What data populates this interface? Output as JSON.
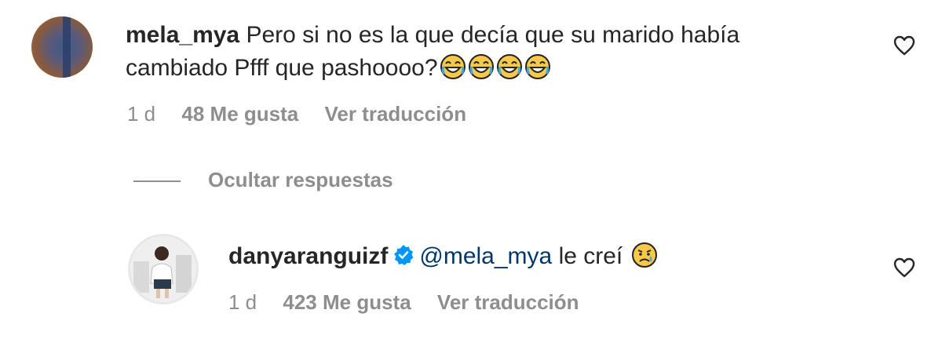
{
  "comments": [
    {
      "username": "mela_mya",
      "text_line1": "Pero si no es la que decía que su marido había",
      "text_line2": "cambiado Pfff que pashoooo?",
      "emoji": "face-with-tears-of-joy",
      "emoji_count": 4,
      "time": "1 d",
      "likes": "48 Me gusta",
      "translate": "Ver traducción",
      "avatar": "avatar"
    }
  ],
  "replies_toggle": "Ocultar respuestas",
  "reply": {
    "username": "danyaranguizf",
    "verified": true,
    "mention": "@mela_mya",
    "text": "le creí",
    "emoji": "sad-but-relieved-face",
    "time": "1 d",
    "likes": "423 Me gusta",
    "translate": "Ver traducción"
  },
  "icons": {
    "like": "heart-icon",
    "verified": "verified-badge-icon"
  },
  "colors": {
    "text": "#262626",
    "secondary": "#8e8e8e",
    "mention": "#00376b",
    "verified": "#0095f6"
  }
}
